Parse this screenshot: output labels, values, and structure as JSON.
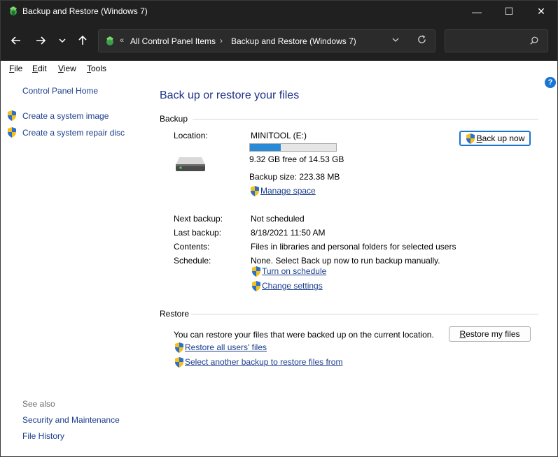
{
  "window": {
    "title": "Backup and Restore (Windows 7)",
    "controls": {
      "minimize": "—",
      "maximize": "☐",
      "close": "✕"
    }
  },
  "address": {
    "overflow": "«",
    "crumbs": [
      "All Control Panel Items",
      "Backup and Restore (Windows 7)"
    ],
    "separator": "›"
  },
  "search": {
    "placeholder": ""
  },
  "menu": [
    {
      "key": "F",
      "rest": "ile"
    },
    {
      "key": "E",
      "rest": "dit"
    },
    {
      "key": "V",
      "rest": "iew"
    },
    {
      "key": "T",
      "rest": "ools"
    }
  ],
  "left": {
    "home": "Control Panel Home",
    "create_image": "Create a system image",
    "create_repair": "Create a system repair disc",
    "see_also": "See also",
    "security": "Security and Maintenance",
    "file_history": "File History"
  },
  "main": {
    "title": "Back up or restore your files",
    "backup": {
      "heading": "Backup",
      "location_label": "Location:",
      "location_value": "MINITOOL (E:)",
      "used_fraction": 0.36,
      "free_text": "9.32 GB free of 14.53 GB",
      "size_text": "Backup size: 223.38 MB",
      "manage_space": "Manage space",
      "backup_now_pre": "B",
      "backup_now_rest": "ack up now",
      "next_label": "Next backup:",
      "next_value": "Not scheduled",
      "last_label": "Last backup:",
      "last_value": "8/18/2021 11:50 AM",
      "contents_label": "Contents:",
      "contents_value": "Files in libraries and personal folders for selected users",
      "schedule_label": "Schedule:",
      "schedule_value": "None. Select Back up now to run backup manually.",
      "turn_on_schedule": "Turn on schedule",
      "change_settings": "Change settings"
    },
    "restore": {
      "heading": "Restore",
      "description": "You can restore your files that were backed up on the current location.",
      "restore_my_files_pre": "R",
      "restore_my_files_rest": "estore my files",
      "restore_all_users": "Restore all users' files",
      "select_another": "Select another backup to restore files from"
    }
  },
  "colors": {
    "link": "#1a3e8c",
    "title": "#1e3287",
    "progress": "#2b8ad6",
    "titlebar": "#202020"
  }
}
